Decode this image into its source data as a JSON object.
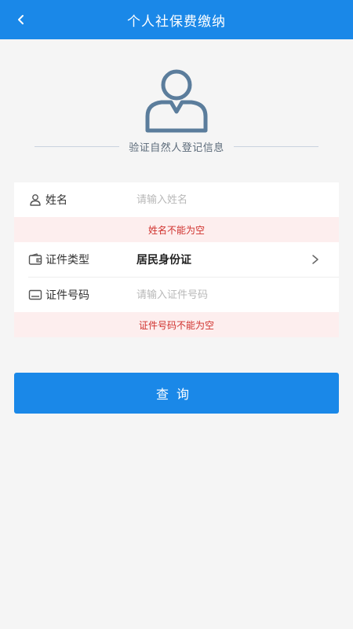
{
  "header": {
    "title": "个人社保费缴纳"
  },
  "hero": {
    "subtitle": "验证自然人登记信息"
  },
  "form": {
    "name": {
      "label": "姓名",
      "placeholder": "请输入姓名",
      "value": "",
      "error": "姓名不能为空"
    },
    "id_type": {
      "label": "证件类型",
      "value": "居民身份证"
    },
    "id_number": {
      "label": "证件号码",
      "placeholder": "请输入证件号码",
      "value": "",
      "error": "证件号码不能为空"
    }
  },
  "actions": {
    "query_label": "查询"
  },
  "colors": {
    "primary": "#1a88e8",
    "error_text": "#d0312d",
    "error_bg": "#fdeeee",
    "avatar": "#5b7d9c"
  }
}
